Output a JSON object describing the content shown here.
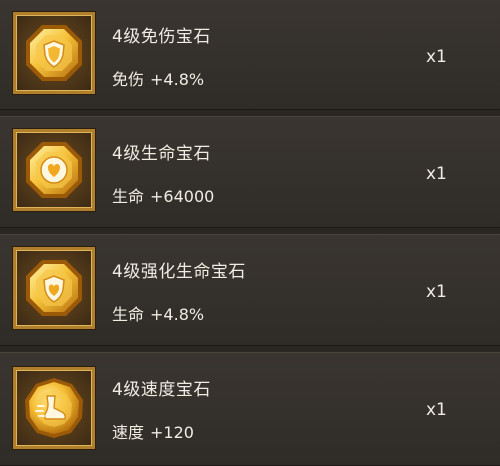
{
  "items": [
    {
      "name": "4级免伤宝石",
      "stat_label": "免伤",
      "stat_value": "+4.8%",
      "quantity": "x1",
      "icon": "shield-icon",
      "gem_shape": "octagon"
    },
    {
      "name": "4级生命宝石",
      "stat_label": "生命",
      "stat_value": "+64000",
      "quantity": "x1",
      "icon": "heart-icon",
      "gem_shape": "octagon"
    },
    {
      "name": "4级强化生命宝石",
      "stat_label": "生命",
      "stat_value": "+4.8%",
      "quantity": "x1",
      "icon": "heart-icon",
      "gem_shape": "octagon"
    },
    {
      "name": "4级速度宝石",
      "stat_label": "速度",
      "stat_value": "+120",
      "quantity": "x1",
      "icon": "boot-icon",
      "gem_shape": "round"
    }
  ],
  "colors": {
    "background": "#2b2722",
    "frame_border": "#b07f2c",
    "gem_light": "#ffe27a",
    "gem_mid": "#f2b12a",
    "gem_dark": "#b8720e",
    "text": "#f0ece2"
  }
}
